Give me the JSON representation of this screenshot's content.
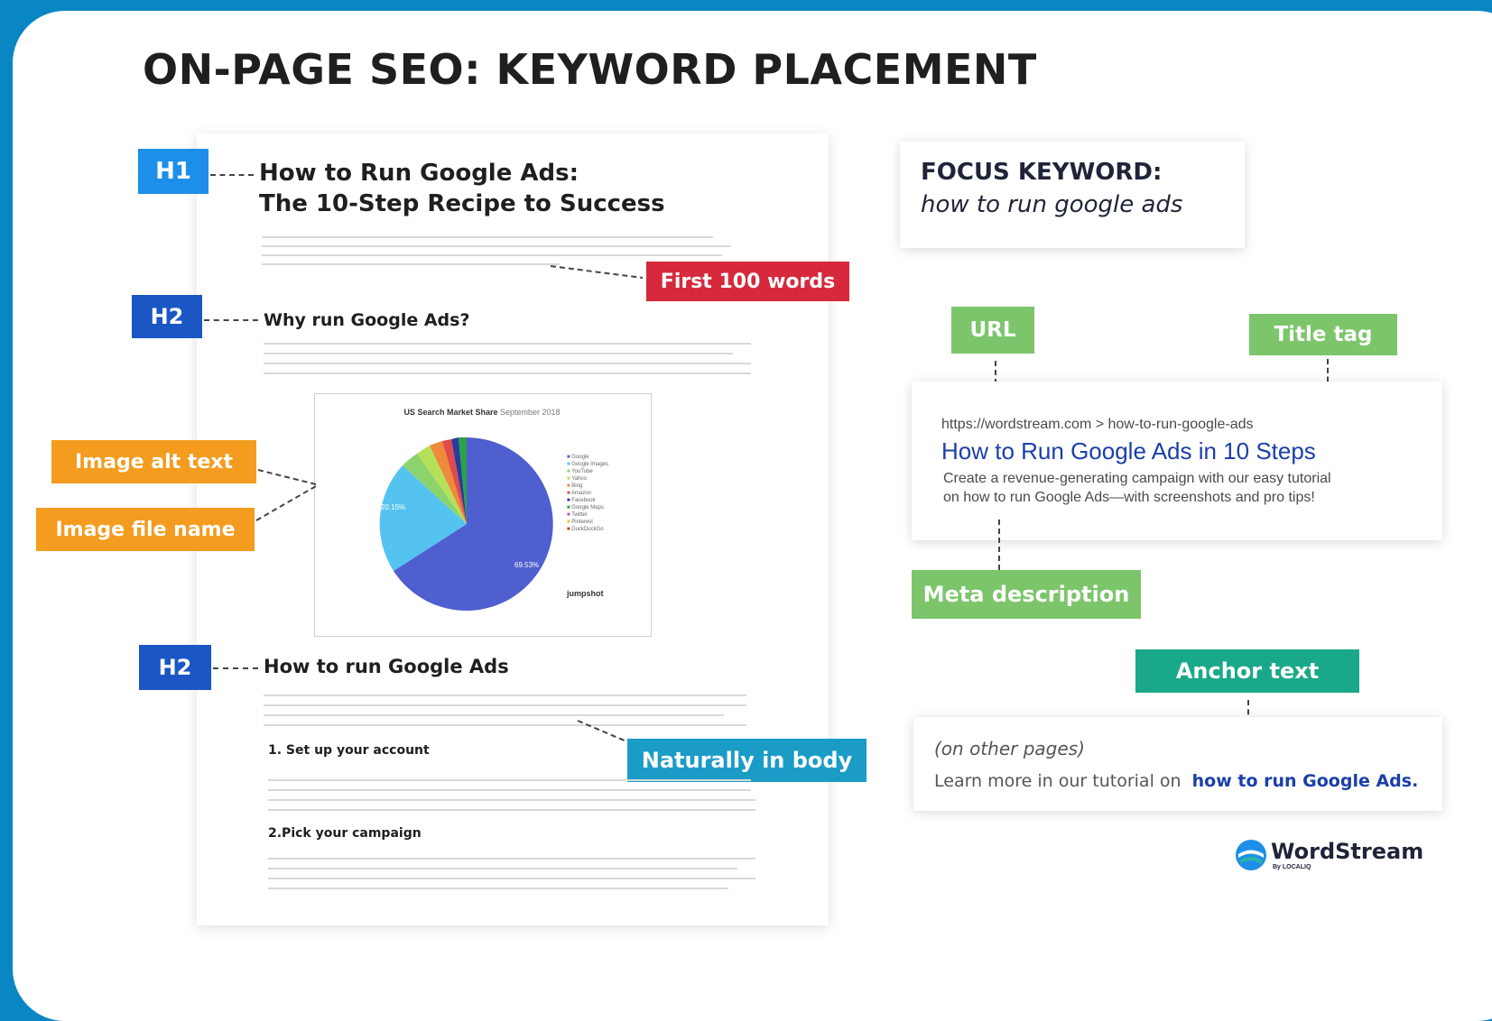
{
  "title": "ON-PAGE SEO: KEYWORD PLACEMENT",
  "document": {
    "h1_tag": "H1",
    "h1_line1": "How to Run Google Ads:",
    "h1_line2": "The 10-Step Recipe to Success",
    "h2_tag_1": "H2",
    "h2_text_1": "Why run Google Ads?",
    "h2_tag_2": "H2",
    "h2_text_2": "How to run Google Ads",
    "step_1": "1. Set up your account",
    "step_2": "2.Pick your campaign",
    "image": {
      "title": "US Search Market Share",
      "subtitle": "September 2018",
      "big_slice_label": "69.53%",
      "light_slice_label": "20.15%",
      "legend": [
        "Google",
        "Google Images",
        "YouTube",
        "Yahoo",
        "Bing",
        "Amazon",
        "Facebook",
        "Google Maps",
        "Twitter",
        "Pinterest",
        "DuckDuckGo"
      ],
      "source_label": "jumpshot"
    }
  },
  "labels": {
    "first_100": "First 100 words",
    "alt_text": "Image alt text",
    "file_name": "Image file name",
    "naturally": "Naturally in body",
    "url": "URL",
    "title_tag": "Title tag",
    "meta_description": "Meta description",
    "anchor_text": "Anchor text"
  },
  "focus": {
    "label": "FOCUS KEYWORD:",
    "keyword": "how to run google ads"
  },
  "serp": {
    "url": "https://wordstream.com > how-to-run-google-ads",
    "title": "How to Run Google Ads in 10 Steps",
    "desc_line1": "Create a revenue-generating campaign with our easy tutorial",
    "desc_line2": "on how to run Google Ads—with screenshots and pro tips!"
  },
  "anchor_box": {
    "note": "(on other pages)",
    "prefix": "Learn more in our tutorial on",
    "link": "how to run Google Ads."
  },
  "brand": {
    "name": "WordStream",
    "byline": "By LOCALIQ"
  },
  "colors": {
    "page_bg": "#0b86c4",
    "h1_tag": "#1e8fe8",
    "h2_tag": "#1a56c4",
    "red_tag": "#d6293c",
    "orange_tag": "#f39c1f",
    "teal_tag": "#1a9cc6",
    "green_tag": "#7cc56b",
    "anchor_tag": "#1aa88a",
    "link_blue": "#1a3fa8"
  }
}
